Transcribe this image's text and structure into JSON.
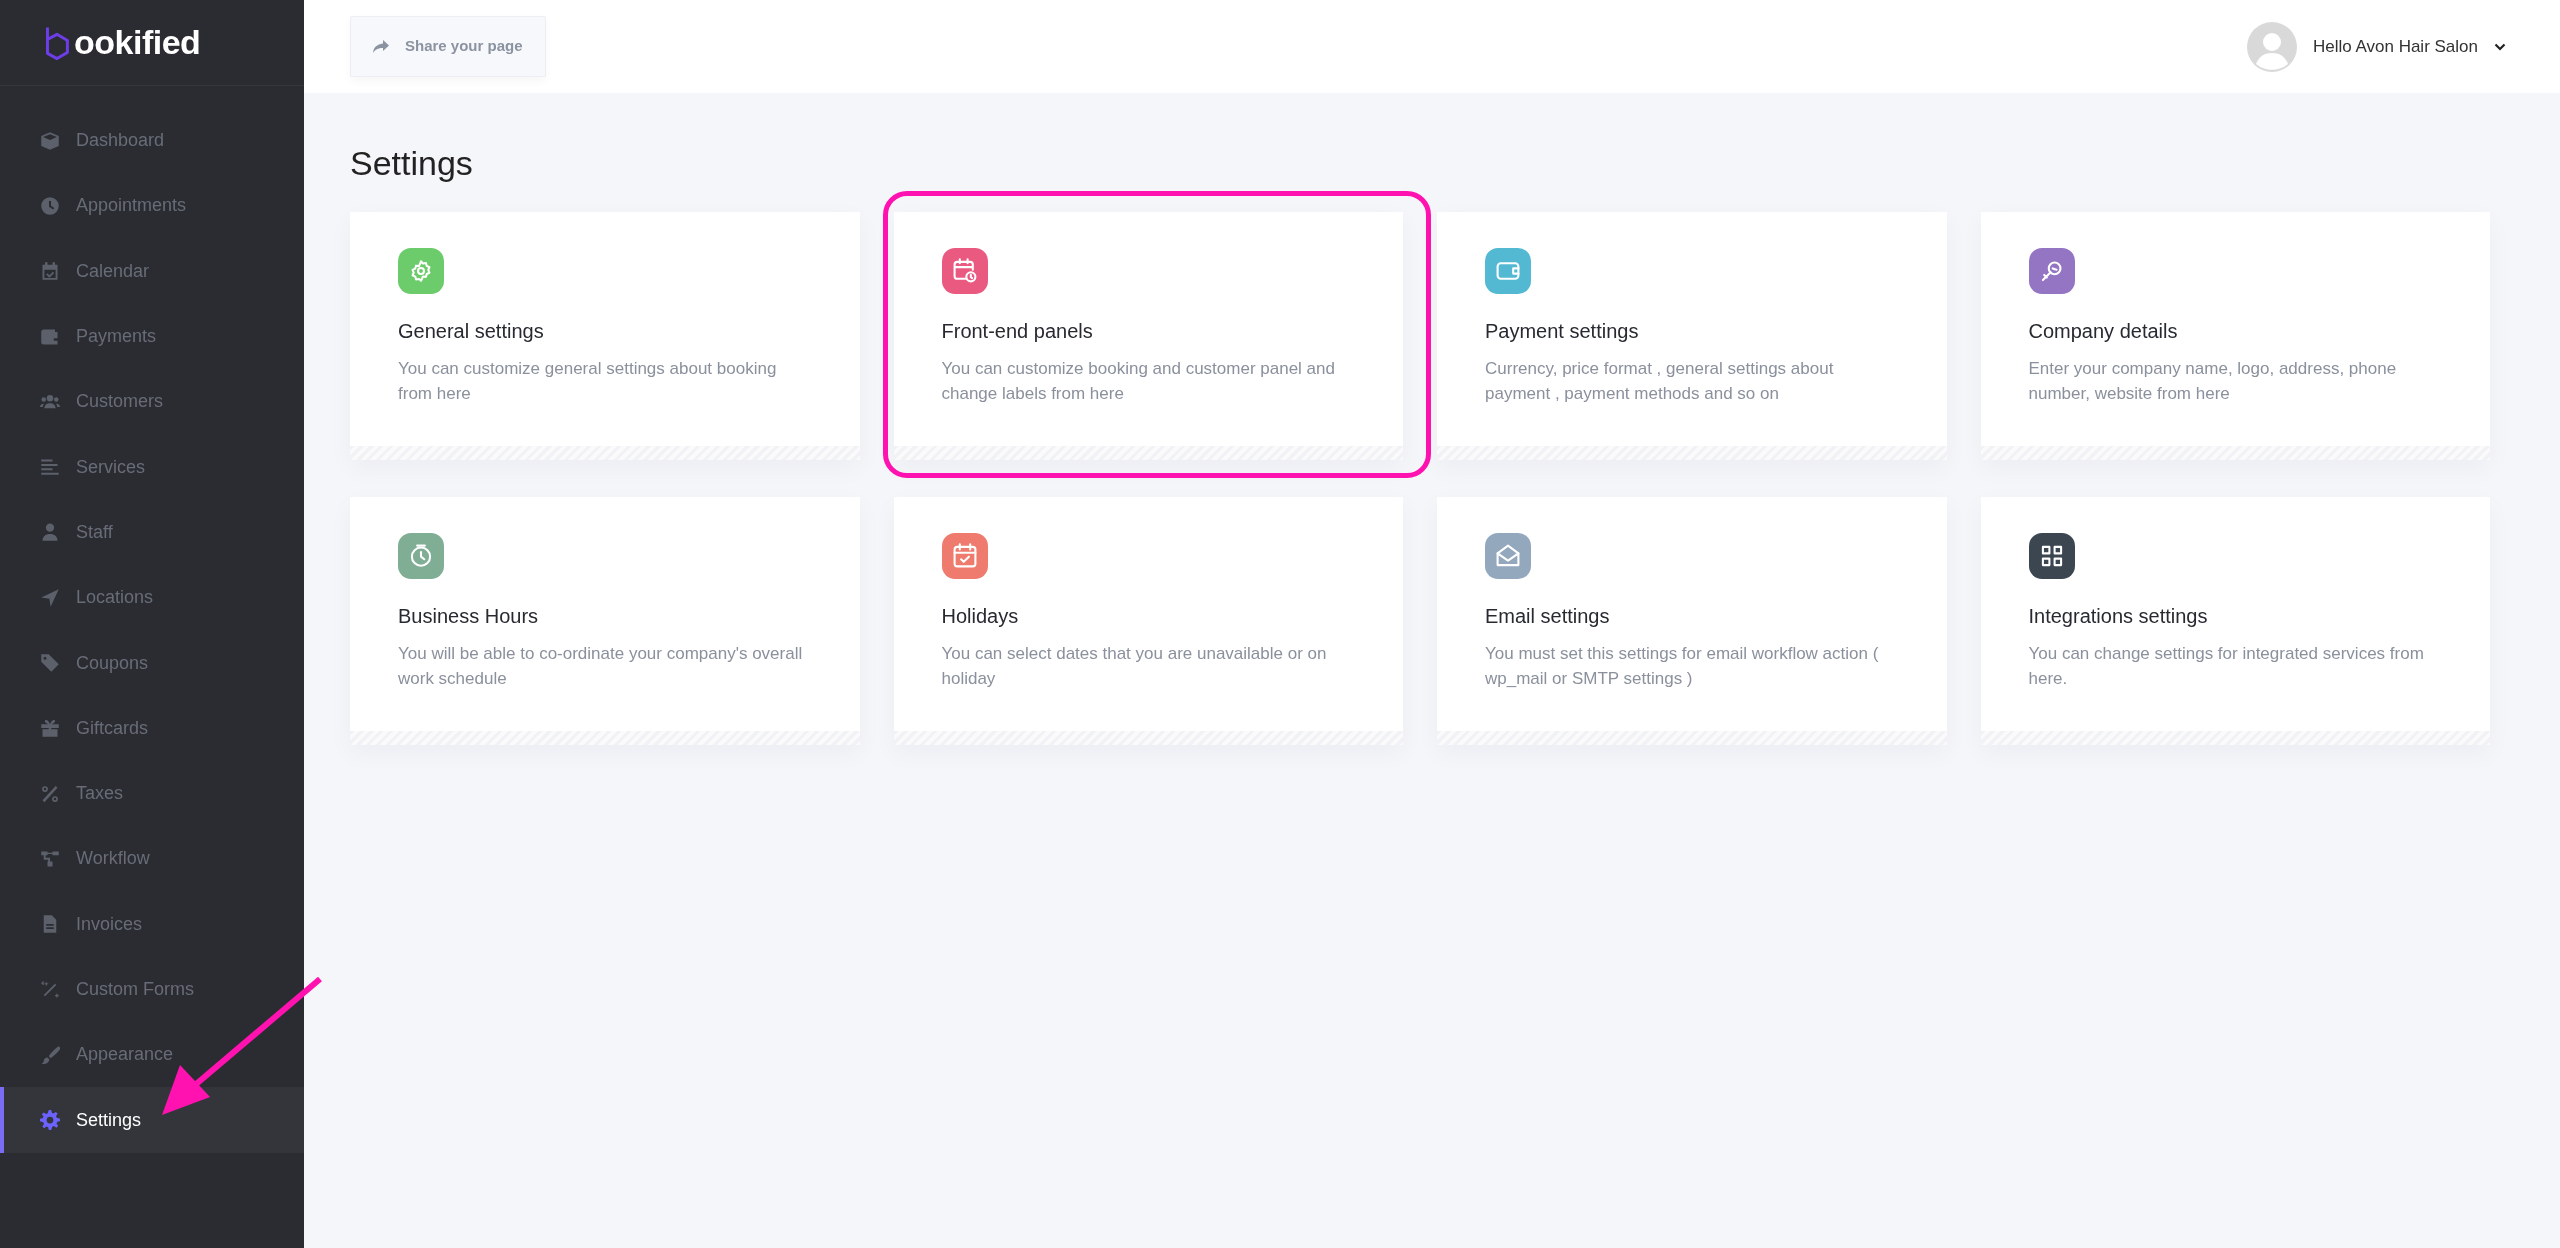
{
  "sidebar": {
    "logo": "ookified",
    "items": [
      {
        "label": "Dashboard",
        "selected": false,
        "arrow": false
      },
      {
        "label": "Appointments",
        "selected": false,
        "arrow": false
      },
      {
        "label": "Calendar",
        "selected": false,
        "arrow": false
      },
      {
        "label": "Payments",
        "selected": false,
        "arrow": false
      },
      {
        "label": "Customers",
        "selected": false,
        "arrow": false
      },
      {
        "label": "Services",
        "selected": false,
        "arrow": false
      },
      {
        "label": "Staff",
        "selected": false,
        "arrow": false
      },
      {
        "label": "Locations",
        "selected": false,
        "arrow": false
      },
      {
        "label": "Coupons",
        "selected": false,
        "arrow": false
      },
      {
        "label": "Giftcards",
        "selected": false,
        "arrow": false
      },
      {
        "label": "Taxes",
        "selected": false,
        "arrow": false
      },
      {
        "label": "Workflow",
        "selected": false,
        "arrow": false
      },
      {
        "label": "Invoices",
        "selected": false,
        "arrow": false
      },
      {
        "label": "Custom Forms",
        "selected": false,
        "arrow": false
      },
      {
        "label": "Appearance",
        "selected": false,
        "arrow": false
      },
      {
        "label": "Settings",
        "selected": true,
        "arrow": true
      }
    ]
  },
  "topbar": {
    "share_button": "Share your page",
    "user": "Hello Avon Hair Salon"
  },
  "page_title": "Settings",
  "cards": [
    {
      "title": "General settings",
      "description": "You can customize general settings about booking from here",
      "color": "#6ccb6a",
      "highlighted": false
    },
    {
      "title": "Front-end panels",
      "description": "You can customize booking and customer panel and change labels from here",
      "color": "#ea5a80",
      "highlighted": true
    },
    {
      "title": "Payment settings",
      "description": "Currency, price format , general settings about payment , payment methods and so on",
      "color": "#53b9d3",
      "highlighted": false
    },
    {
      "title": "Company details",
      "description": "Enter your company name, logo, address, phone number, website from here",
      "color": "#9475c4",
      "highlighted": false
    },
    {
      "title": "Business Hours",
      "description": "You will be able to co-ordinate your company's overall work schedule",
      "color": "#7fae94",
      "highlighted": false
    },
    {
      "title": "Holidays",
      "description": "You can select dates that you are unavailable or on holiday",
      "color": "#ef7a6e",
      "highlighted": false
    },
    {
      "title": "Email settings",
      "description": "You must set this settings for email workflow action ( wp_mail or SMTP settings )",
      "color": "#93a7bd",
      "highlighted": false
    },
    {
      "title": "Integrations settings",
      "description": "You can change settings for integrated services from here.",
      "color": "#3c4651",
      "highlighted": false
    }
  ]
}
